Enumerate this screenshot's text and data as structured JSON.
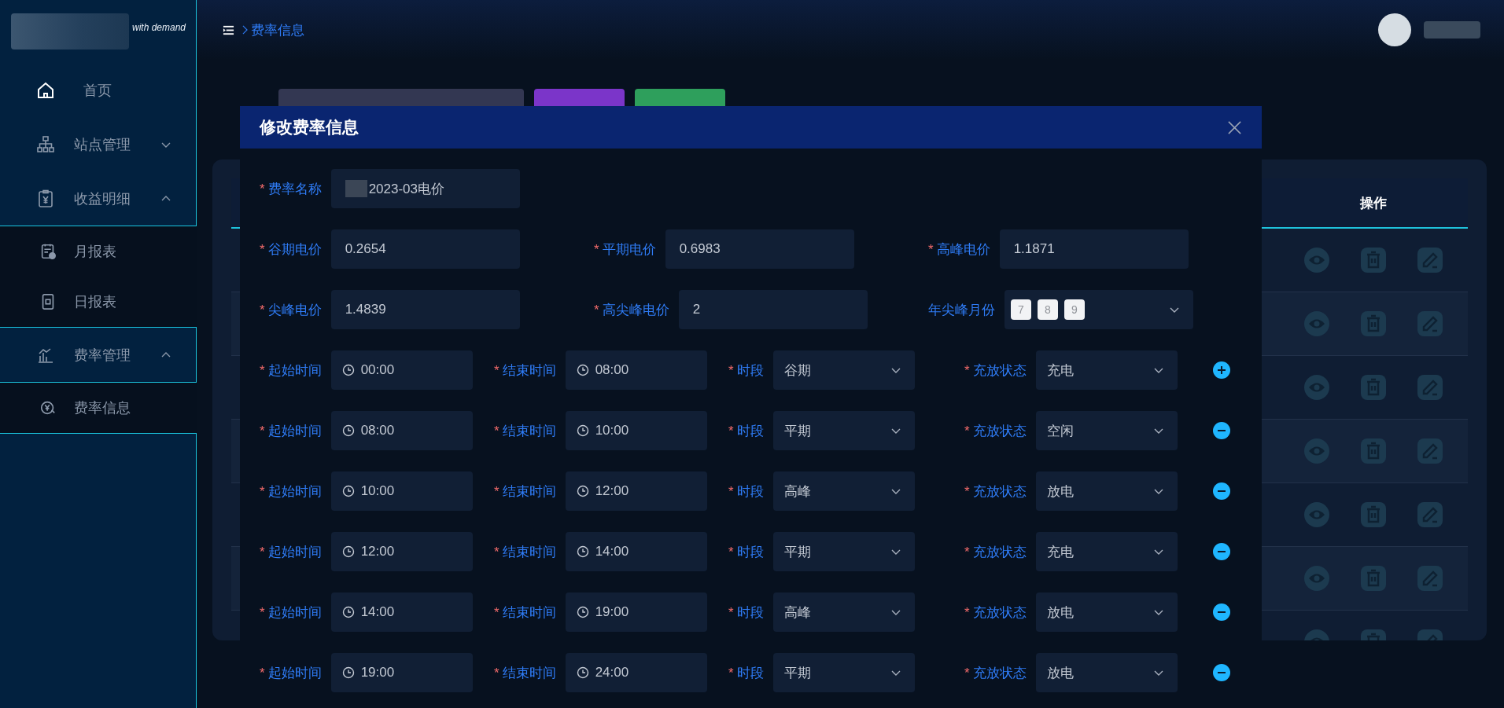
{
  "sidebar": {
    "brand_text": "with demand",
    "items": [
      {
        "label": "首页"
      },
      {
        "label": "站点管理",
        "expanded": false
      },
      {
        "label": "收益明细",
        "expanded": true,
        "children": [
          {
            "label": "月报表"
          },
          {
            "label": "日报表"
          }
        ]
      },
      {
        "label": "费率管理",
        "expanded": true,
        "children": [
          {
            "label": "费率信息"
          }
        ]
      }
    ]
  },
  "header": {
    "breadcrumb": [
      "费率信息"
    ]
  },
  "filter": {
    "buttons": [
      {
        "kind": "search"
      },
      {
        "kind": "add"
      }
    ]
  },
  "table": {
    "columns": [
      "操作"
    ]
  },
  "dialog": {
    "title": "修改费率信息",
    "form_rows": [
      [
        {
          "mark": "*",
          "label": "费率名称",
          "kind": "text",
          "value": "2023-03电价",
          "masked": true
        }
      ],
      [
        {
          "mark": "*",
          "label": "谷期电价",
          "kind": "text",
          "value": "0.2654"
        },
        {
          "mark": "*",
          "label": "平期电价",
          "kind": "text",
          "value": "0.6983"
        },
        {
          "mark": "*",
          "label": "高峰电价",
          "kind": "text",
          "value": "1.1871"
        }
      ],
      [
        {
          "mark": "*",
          "label": "尖峰电价",
          "kind": "text",
          "value": "1.4839"
        },
        {
          "mark": "*",
          "label": "高尖峰电价",
          "kind": "text",
          "value": "2"
        },
        {
          "label": "年尖峰月份",
          "kind": "tags",
          "tags": [
            "7",
            "8",
            "9"
          ]
        }
      ]
    ],
    "time_rows": [
      {
        "kind": "add",
        "fields": [
          {
            "mark": "*",
            "label": "起始时间",
            "kind": "time",
            "value": "00:00"
          },
          {
            "mark": "*",
            "label": "结束时间",
            "kind": "time",
            "value": "08:00"
          },
          {
            "mark": "*",
            "label": "时段",
            "kind": "select",
            "value": "谷期"
          },
          {
            "mark": "*",
            "label": "充放状态",
            "kind": "select",
            "value": "充电"
          }
        ]
      },
      {
        "kind": "remove",
        "fields": [
          {
            "mark": "*",
            "label": "起始时间",
            "kind": "time",
            "value": "08:00"
          },
          {
            "mark": "*",
            "label": "结束时间",
            "kind": "time",
            "value": "10:00"
          },
          {
            "mark": "*",
            "label": "时段",
            "kind": "select",
            "value": "平期"
          },
          {
            "mark": "*",
            "label": "充放状态",
            "kind": "select",
            "value": "空闲"
          }
        ]
      },
      {
        "kind": "remove",
        "fields": [
          {
            "mark": "*",
            "label": "起始时间",
            "kind": "time",
            "value": "10:00"
          },
          {
            "mark": "*",
            "label": "结束时间",
            "kind": "time",
            "value": "12:00"
          },
          {
            "mark": "*",
            "label": "时段",
            "kind": "select",
            "value": "高峰"
          },
          {
            "mark": "*",
            "label": "充放状态",
            "kind": "select",
            "value": "放电"
          }
        ]
      },
      {
        "kind": "remove",
        "fields": [
          {
            "mark": "*",
            "label": "起始时间",
            "kind": "time",
            "value": "12:00"
          },
          {
            "mark": "*",
            "label": "结束时间",
            "kind": "time",
            "value": "14:00"
          },
          {
            "mark": "*",
            "label": "时段",
            "kind": "select",
            "value": "平期"
          },
          {
            "mark": "*",
            "label": "充放状态",
            "kind": "select",
            "value": "充电"
          }
        ]
      },
      {
        "kind": "remove",
        "fields": [
          {
            "mark": "*",
            "label": "起始时间",
            "kind": "time",
            "value": "14:00"
          },
          {
            "mark": "*",
            "label": "结束时间",
            "kind": "time",
            "value": "19:00"
          },
          {
            "mark": "*",
            "label": "时段",
            "kind": "select",
            "value": "高峰"
          },
          {
            "mark": "*",
            "label": "充放状态",
            "kind": "select",
            "value": "放电"
          }
        ]
      },
      {
        "kind": "remove",
        "fields": [
          {
            "mark": "*",
            "label": "起始时间",
            "kind": "time",
            "value": "19:00"
          },
          {
            "mark": "*",
            "label": "结束时间",
            "kind": "time",
            "value": "24:00"
          },
          {
            "mark": "*",
            "label": "时段",
            "kind": "select",
            "value": "平期"
          },
          {
            "mark": "*",
            "label": "充放状态",
            "kind": "select",
            "value": "放电"
          }
        ]
      }
    ]
  }
}
